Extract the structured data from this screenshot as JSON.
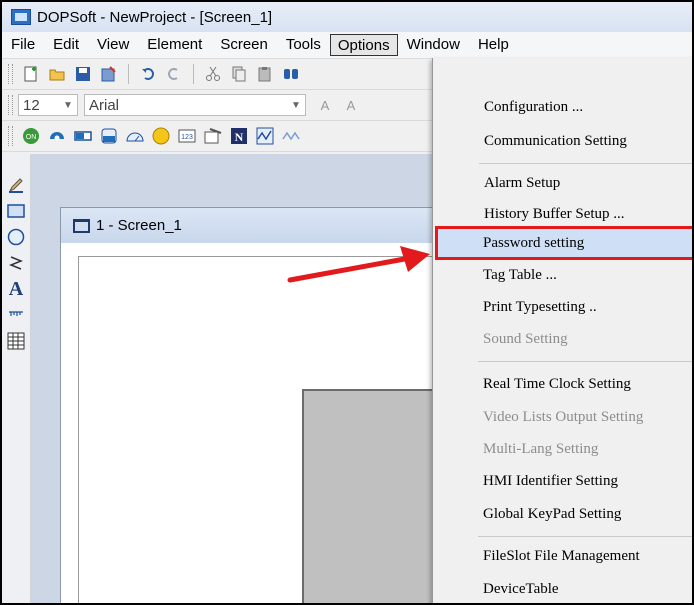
{
  "window": {
    "title": "DOPSoft - NewProject - [Screen_1]"
  },
  "menubar": {
    "items": [
      "File",
      "Edit",
      "View",
      "Element",
      "Screen",
      "Tools",
      "Options",
      "Window",
      "Help"
    ]
  },
  "format_toolbar": {
    "font_size": "12",
    "font_name": "Arial",
    "align_glyph_1": "A",
    "align_glyph_2": "A"
  },
  "document": {
    "tab_title": "1 - Screen_1"
  },
  "options_menu": {
    "items": [
      {
        "label": "Configuration ...",
        "enabled": true
      },
      {
        "label": "Communication Setting",
        "enabled": true
      },
      {
        "label": "Alarm Setup",
        "enabled": true
      },
      {
        "label": "History Buffer Setup ...",
        "enabled": true
      },
      {
        "label": "Password setting",
        "enabled": true,
        "highlighted": true
      },
      {
        "label": "Tag Table ...",
        "enabled": true
      },
      {
        "label": "Print Typesetting ..",
        "enabled": true
      },
      {
        "label": "Sound Setting",
        "enabled": false
      },
      {
        "label": "Real Time Clock Setting",
        "enabled": true
      },
      {
        "label": "Video Lists Output Setting",
        "enabled": false
      },
      {
        "label": "Multi-Lang Setting",
        "enabled": false
      },
      {
        "label": "HMI Identifier Setting",
        "enabled": true
      },
      {
        "label": "Global KeyPad Setting",
        "enabled": true
      },
      {
        "label": "FileSlot File Management",
        "enabled": true
      },
      {
        "label": "DeviceTable",
        "enabled": true
      }
    ]
  },
  "annotation": {
    "highlight_color": "#e31a1c",
    "arrow_color": "#e31a1c"
  },
  "colors": {
    "accent": "#2a6fc9",
    "menu_bg": "#f0f0f0",
    "disabled_text": "#8d8d8d"
  }
}
